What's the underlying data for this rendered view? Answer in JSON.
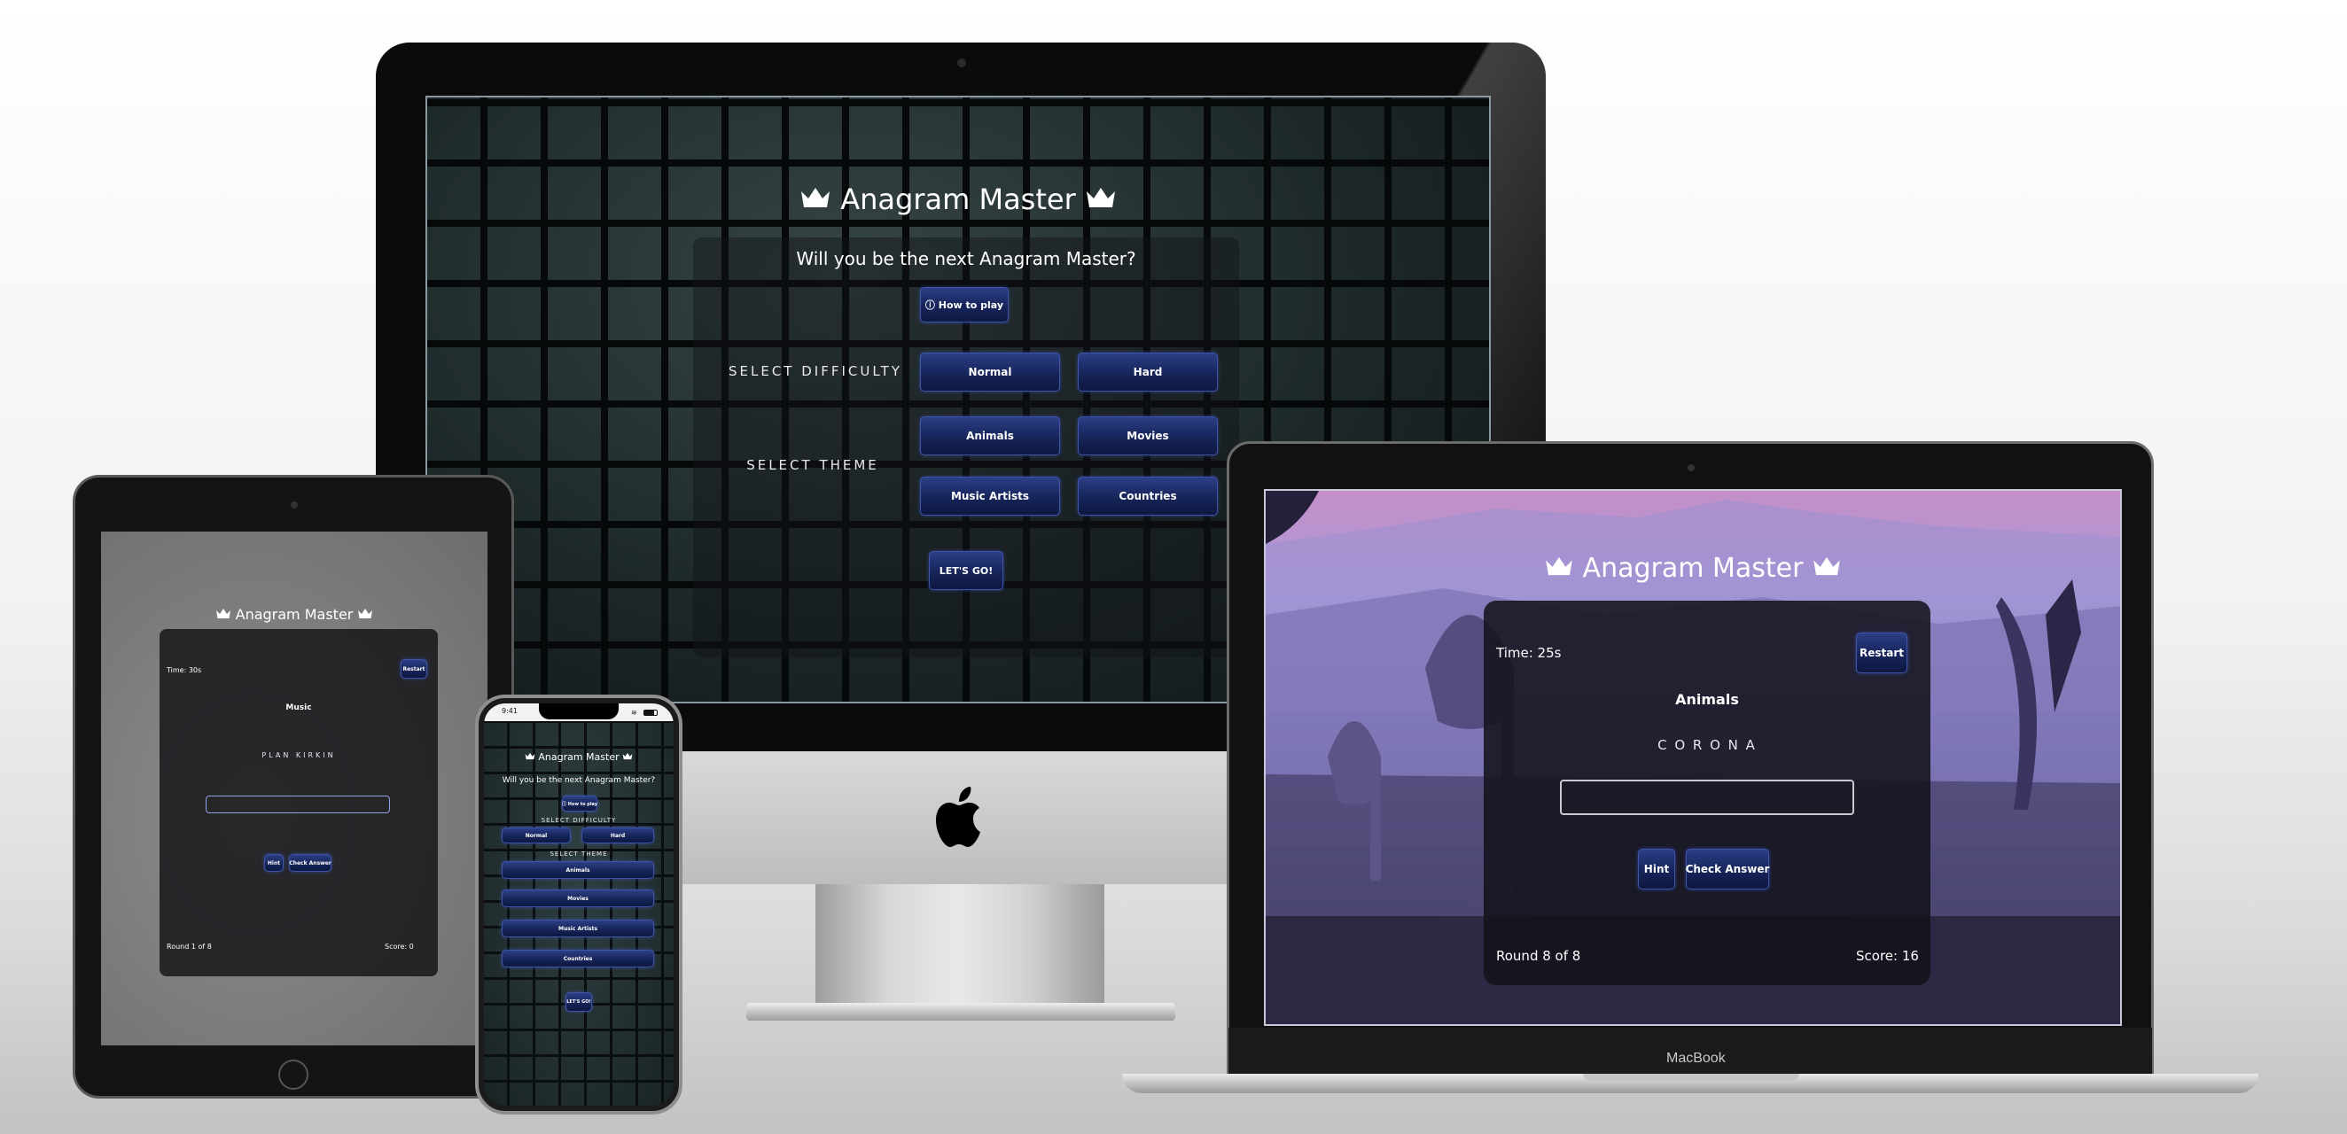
{
  "colors": {
    "button_bg": "#162459",
    "button_border": "#3e55a8",
    "panel_bg": "#141418",
    "text": "#ffffff"
  },
  "imac": {
    "title": "Anagram Master",
    "subtitle": "Will you be the next Anagram Master?",
    "how_to_play": "ⓘ How to play",
    "select_difficulty": "SELECT DIFFICULTY",
    "difficulty": [
      "Normal",
      "Hard"
    ],
    "select_theme": "SELECT THEME",
    "themes": [
      "Animals",
      "Movies",
      "Music Artists",
      "Countries"
    ],
    "start": "LET'S GO!"
  },
  "laptop": {
    "title": "Anagram Master",
    "time": "Time: 25s",
    "restart": "Restart",
    "theme": "Animals",
    "anagram": "C O R O N A",
    "answer_value": "",
    "hint": "Hint",
    "check": "Check Answer",
    "round": "Round 8 of 8",
    "score": "Score: 16",
    "brand": "MacBook"
  },
  "ipad": {
    "title": "Anagram Master",
    "time": "Time: 30s",
    "restart": "Restart",
    "theme": "Music",
    "anagram": "PLAN KIRKIN",
    "hint": "Hint",
    "check": "Check Answer",
    "round": "Round 1 of 8",
    "score": "Score: 0"
  },
  "iphone": {
    "clock": "9:41",
    "title": "Anagram Master",
    "subtitle": "Will you be the next Anagram Master?",
    "how_to_play": "ⓘ How to play",
    "select_difficulty": "SELECT DIFFICULTY",
    "difficulty": [
      "Normal",
      "Hard"
    ],
    "select_theme": "SELECT THEME",
    "themes": [
      "Animals",
      "Movies",
      "Music Artists",
      "Countries"
    ],
    "start": "LET'S GO!"
  },
  "icons": [
    "crown-icon",
    "apple-logo-icon",
    "info-icon",
    "wifi-icon",
    "battery-icon",
    "signal-icon"
  ]
}
